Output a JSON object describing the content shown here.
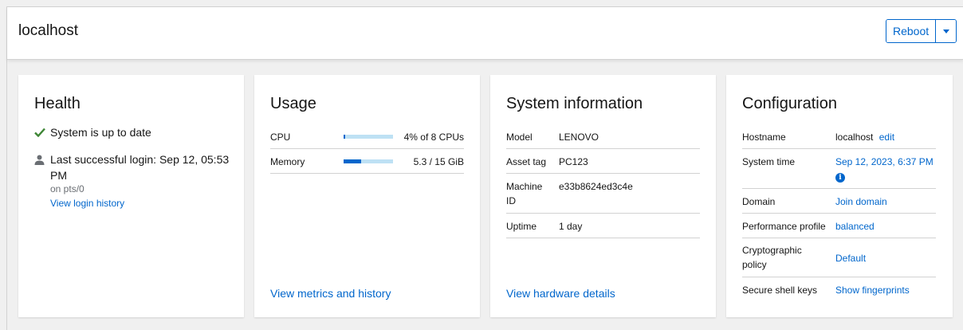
{
  "header": {
    "title": "localhost",
    "reboot_label": "Reboot"
  },
  "health": {
    "title": "Health",
    "status": "System is up to date",
    "login_line1": "Last successful login: Sep 12, 05:53",
    "login_line2": "PM",
    "login_sub": "on pts/0",
    "history_link": "View login history"
  },
  "usage": {
    "title": "Usage",
    "rows": [
      {
        "label": "CPU",
        "value": "4% of 8 CPUs",
        "fraction": 0.04
      },
      {
        "label": "Memory",
        "value": "5.3 / 15 GiB",
        "fraction": 0.35
      }
    ],
    "footer_link": "View metrics and history"
  },
  "system": {
    "title": "System information",
    "model_label": "Model",
    "model_value": "LENOVO",
    "asset_label": "Asset tag",
    "asset_value": "PC123",
    "machine_label_1": "Machine",
    "machine_label_2": "ID",
    "machine_value": "e33b8624ed3c4e",
    "uptime_label": "Uptime",
    "uptime_value": "1 day",
    "footer_link": "View hardware details"
  },
  "config": {
    "title": "Configuration",
    "hostname_label": "Hostname",
    "hostname_value": "localhost",
    "hostname_edit": "edit",
    "time_label": "System time",
    "time_value": "Sep 12, 2023, 6:37 PM",
    "time_info": "i",
    "domain_label": "Domain",
    "domain_value": "Join domain",
    "perf_label": "Performance profile",
    "perf_value": "balanced",
    "crypto_label_1": "Cryptographic",
    "crypto_label_2": "policy",
    "crypto_value": "Default",
    "ssh_label": "Secure shell keys",
    "ssh_value": "Show fingerprints"
  },
  "colors": {
    "accent": "#0066cc",
    "success": "#3e8635",
    "bar_track": "#bee1f4"
  }
}
